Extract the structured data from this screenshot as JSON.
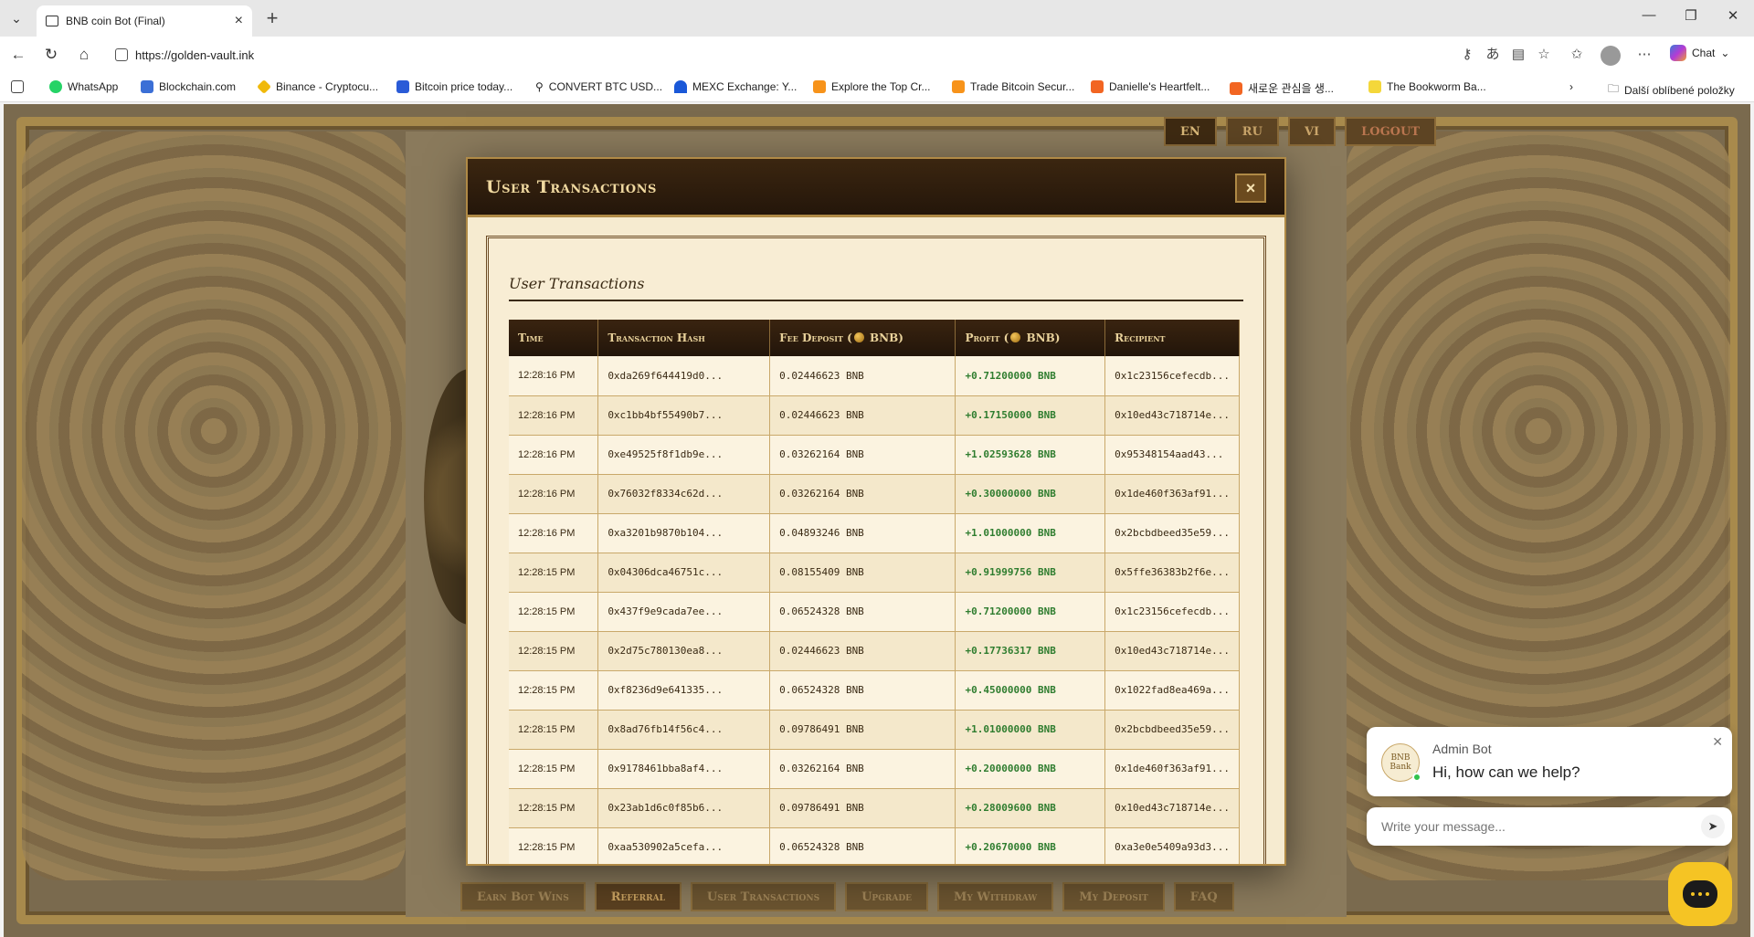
{
  "browser": {
    "tab_title": "BNB coin Bot (Final)",
    "url": "https://golden-vault.ink",
    "chat_label": "Chat",
    "bookmarks": [
      "WhatsApp",
      "Blockchain.com",
      "Binance - Cryptocu...",
      "Bitcoin price today...",
      "CONVERT BTC USD...",
      "MEXC Exchange: Y...",
      "Explore the Top Cr...",
      "Trade Bitcoin Secur...",
      "Danielle's Heartfelt...",
      "새로운 관심을 생...",
      "The Bookworm Ba..."
    ],
    "other_bookmarks": "Další oblíbené položky"
  },
  "header": {
    "lang_buttons": [
      "EN",
      "RU",
      "VI"
    ],
    "logout": "LOGOUT"
  },
  "bottom_nav": [
    "Earn Bot Wins",
    "Referral",
    "User Transactions",
    "Upgrade",
    "My Withdraw",
    "My Deposit",
    "FAQ"
  ],
  "modal": {
    "title": "User Transactions",
    "close": "×",
    "section_title": "User Transactions",
    "columns": {
      "time": "Time",
      "hash": "Transaction Hash",
      "fee_prefix": "Fee Deposit (",
      "profit_prefix": "Profit (",
      "unit_suffix": " BNB)",
      "recipient": "Recipient"
    },
    "rows": [
      {
        "time": "12:28:16 PM",
        "hash": "0xda269f644419d0...",
        "fee": "0.02446623 BNB",
        "profit": "+0.71200000 BNB",
        "recipient": "0x1c23156cefecdb..."
      },
      {
        "time": "12:28:16 PM",
        "hash": "0xc1bb4bf55490b7...",
        "fee": "0.02446623 BNB",
        "profit": "+0.17150000 BNB",
        "recipient": "0x10ed43c718714e..."
      },
      {
        "time": "12:28:16 PM",
        "hash": "0xe49525f8f1db9e...",
        "fee": "0.03262164 BNB",
        "profit": "+1.02593628 BNB",
        "recipient": "0x95348154aad43..."
      },
      {
        "time": "12:28:16 PM",
        "hash": "0x76032f8334c62d...",
        "fee": "0.03262164 BNB",
        "profit": "+0.30000000 BNB",
        "recipient": "0x1de460f363af91..."
      },
      {
        "time": "12:28:16 PM",
        "hash": "0xa3201b9870b104...",
        "fee": "0.04893246 BNB",
        "profit": "+1.01000000 BNB",
        "recipient": "0x2bcbdbeed35e59..."
      },
      {
        "time": "12:28:15 PM",
        "hash": "0x04306dca46751c...",
        "fee": "0.08155409 BNB",
        "profit": "+0.91999756 BNB",
        "recipient": "0x5ffe36383b2f6e..."
      },
      {
        "time": "12:28:15 PM",
        "hash": "0x437f9e9cada7ee...",
        "fee": "0.06524328 BNB",
        "profit": "+0.71200000 BNB",
        "recipient": "0x1c23156cefecdb..."
      },
      {
        "time": "12:28:15 PM",
        "hash": "0x2d75c780130ea8...",
        "fee": "0.02446623 BNB",
        "profit": "+0.17736317 BNB",
        "recipient": "0x10ed43c718714e..."
      },
      {
        "time": "12:28:15 PM",
        "hash": "0xf8236d9e641335...",
        "fee": "0.06524328 BNB",
        "profit": "+0.45000000 BNB",
        "recipient": "0x1022fad8ea469a..."
      },
      {
        "time": "12:28:15 PM",
        "hash": "0x8ad76fb14f56c4...",
        "fee": "0.09786491 BNB",
        "profit": "+1.01000000 BNB",
        "recipient": "0x2bcbdbeed35e59..."
      },
      {
        "time": "12:28:15 PM",
        "hash": "0x9178461bba8af4...",
        "fee": "0.03262164 BNB",
        "profit": "+0.20000000 BNB",
        "recipient": "0x1de460f363af91..."
      },
      {
        "time": "12:28:15 PM",
        "hash": "0x23ab1d6c0f85b6...",
        "fee": "0.09786491 BNB",
        "profit": "+0.28009600 BNB",
        "recipient": "0x10ed43c718714e..."
      },
      {
        "time": "12:28:15 PM",
        "hash": "0xaa530902a5cefa...",
        "fee": "0.06524328 BNB",
        "profit": "+0.20670000 BNB",
        "recipient": "0xa3e0e5409a93d3..."
      }
    ]
  },
  "chat_widget": {
    "name": "Admin Bot",
    "avatar_text": "BNB Bank",
    "message": "Hi, how can we help?",
    "input_placeholder": "Write your message..."
  },
  "colors": {
    "profit_green": "#2f7d2f",
    "header_dark": "#24160a",
    "gold": "#b08a46",
    "chat_fab": "#f5c424"
  }
}
